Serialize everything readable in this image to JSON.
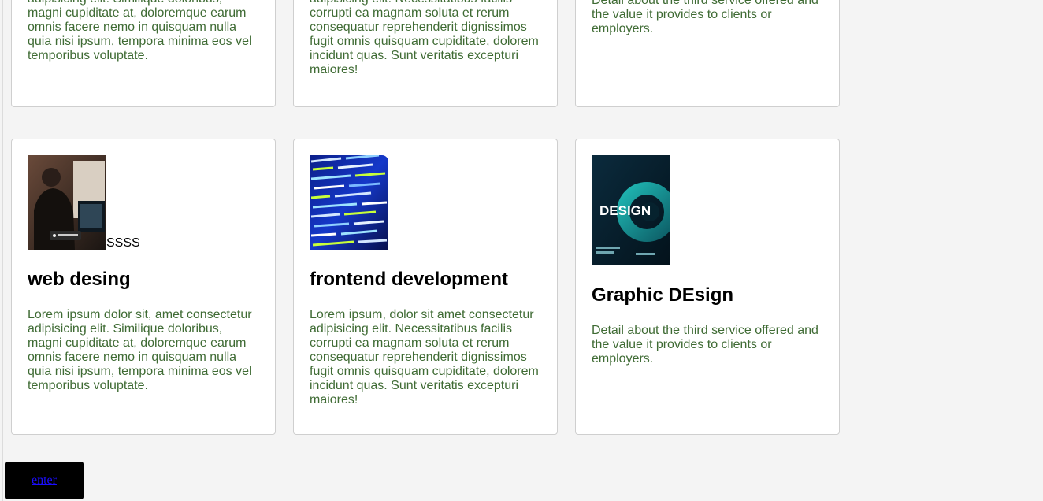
{
  "top_cards": [
    {
      "text": "Lorem ipsum dolor sit, amet consectetur adipisicing elit. Similique doloribus, magni cupiditate at, doloremque earum omnis facere nemo in quisquam nulla quia nisi ipsum, tempora minima eos vel temporibus voluptate."
    },
    {
      "text": "Lorem ipsum, dolor sit amet consectetur adipisicing elit. Necessitatibus facilis corrupti ea magnam soluta et rerum consequatur reprehenderit dignissimos fugit omnis quisquam cupiditate, dolorem incidunt quas. Sunt veritatis excepturi maiores!"
    },
    {
      "text": "Detail about the third service offered and the value it provides to clients or employers."
    }
  ],
  "bottom_cards": [
    {
      "image_alt": "SSSS",
      "title": "web desing",
      "text": "Lorem ipsum dolor sit, amet consectetur adipisicing elit. Similique doloribus, magni cupiditate at, doloremque earum omnis facere nemo in quisquam nulla quia nisi ipsum, tempora minima eos vel temporibus voluptate."
    },
    {
      "title": "frontend development",
      "text": "Lorem ipsum, dolor sit amet consectetur adipisicing elit. Necessitatibus facilis corrupti ea magnam soluta et rerum consequatur reprehenderit dignissimos fugit omnis quisquam cupiditate, dolorem incidunt quas. Sunt veritatis excepturi maiores!"
    },
    {
      "image_text": "DESIGN",
      "title": "Graphic DEsign",
      "text": "Detail about the third service offered and the value it provides to clients or employers."
    }
  ],
  "enter_button": {
    "label": "enter"
  },
  "colors": {
    "page_background": "#f4f4f4",
    "card_background": "#ffffff",
    "card_text": "#3f6b34",
    "button_background": "#000000",
    "button_link": "#1a0dff"
  }
}
